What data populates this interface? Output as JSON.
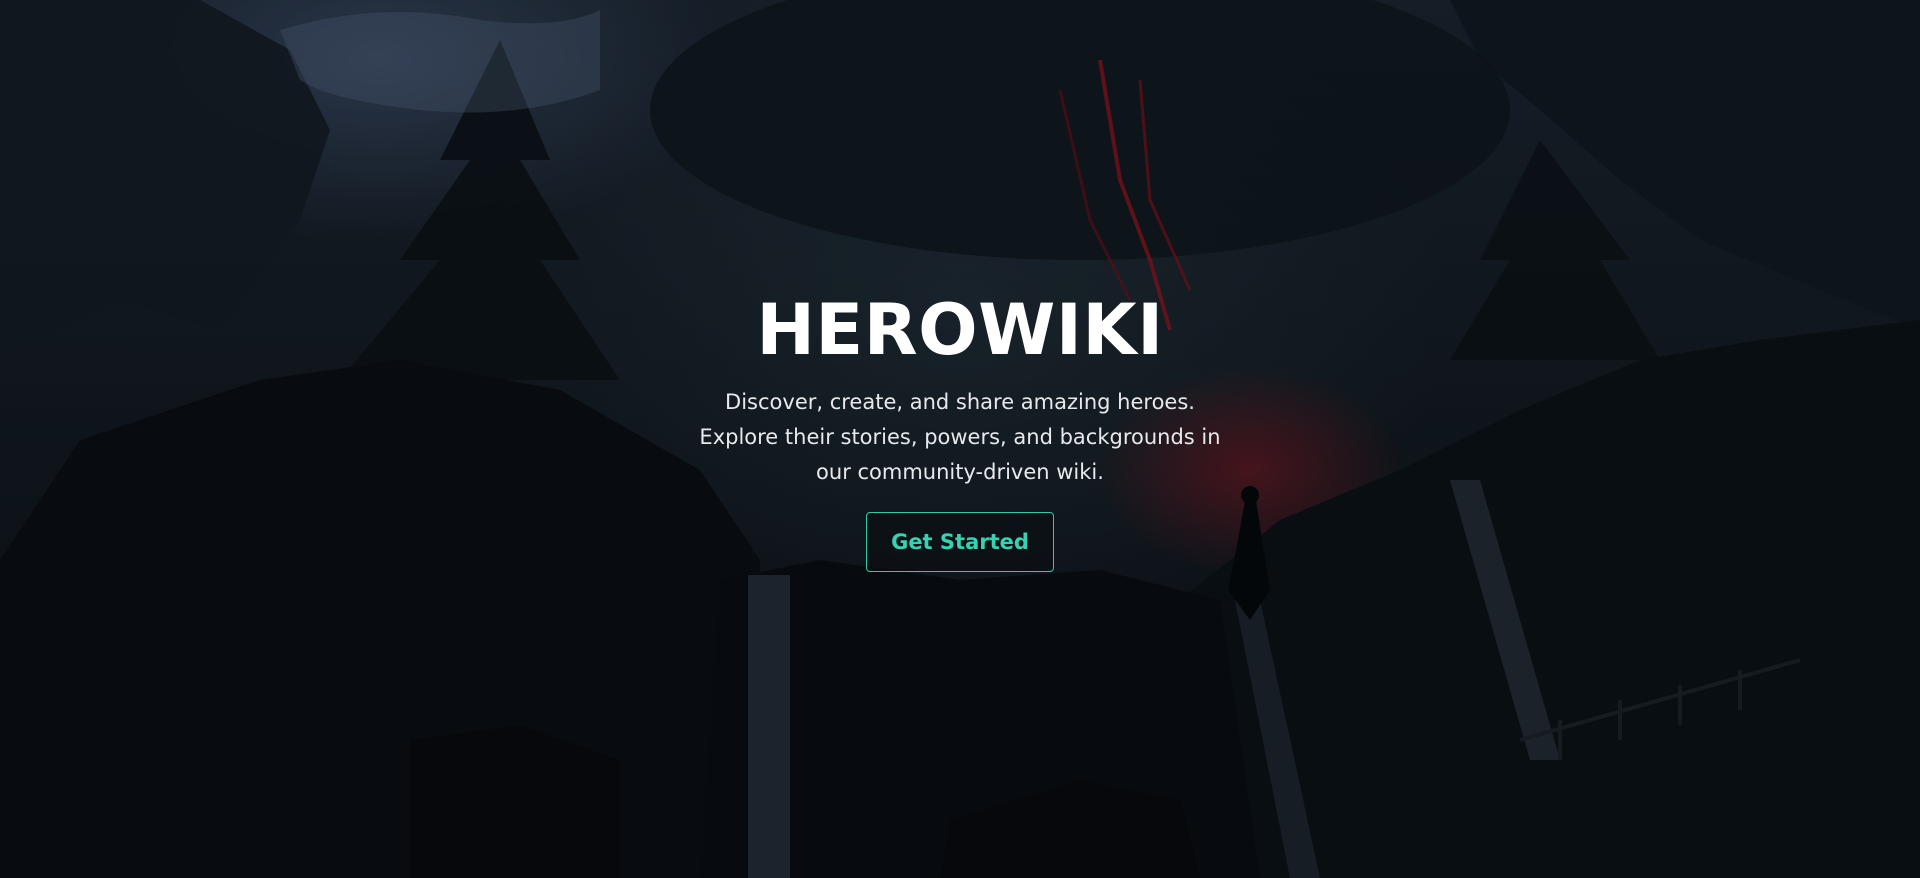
{
  "hero": {
    "title": "HEROWIKI",
    "description": "Discover, create, and share amazing heroes. Explore their stories, powers, and backgrounds in our community-driven wiki.",
    "cta_label": "Get Started"
  },
  "colors": {
    "accent": "#2fcaa8",
    "title_text": "#ffffff",
    "body_text": "#e7e9ec",
    "background": "#0d1116",
    "glow": "#96141e"
  }
}
